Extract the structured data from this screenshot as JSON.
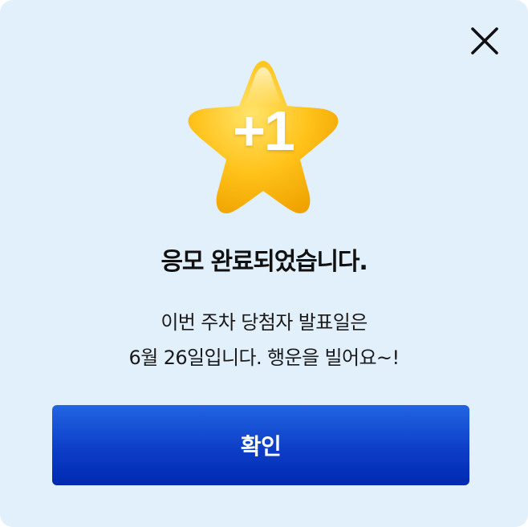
{
  "modal": {
    "close_icon": "close-icon",
    "badge": {
      "icon": "star-icon",
      "label": "+1",
      "colors": {
        "star_light": "#FFE36A",
        "star_mid": "#FFC21A",
        "star_dark": "#F0A300"
      }
    },
    "title": "응모 완료되었습니다.",
    "description": {
      "line1": "이번 주차 당첨자 발표일은",
      "line2": "6월 26일입니다. 행운을 빌어요~!"
    },
    "confirm_button": {
      "label": "확인",
      "color": "#0D3EC8"
    },
    "background_color": "#E2F0FC"
  }
}
